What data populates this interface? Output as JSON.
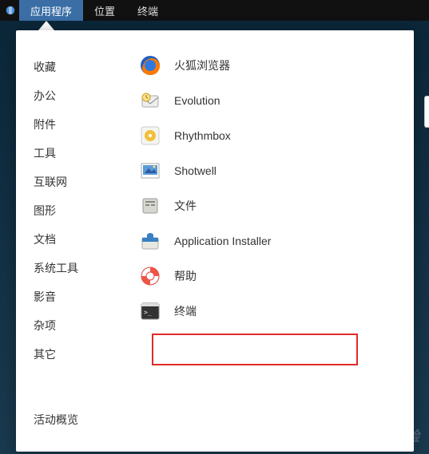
{
  "topbar": {
    "items": [
      {
        "label": "应用程序",
        "active": true
      },
      {
        "label": "位置",
        "active": false
      },
      {
        "label": "终端",
        "active": false
      }
    ]
  },
  "menu": {
    "categories": [
      "收藏",
      "办公",
      "附件",
      "工具",
      "互联网",
      "图形",
      "文档",
      "系统工具",
      "影音",
      "杂项",
      "其它"
    ],
    "activities_label": "活动概览",
    "apps": [
      {
        "name": "火狐浏览器",
        "icon": "firefox-icon"
      },
      {
        "name": "Evolution",
        "icon": "evolution-icon"
      },
      {
        "name": "Rhythmbox",
        "icon": "rhythmbox-icon"
      },
      {
        "name": "Shotwell",
        "icon": "shotwell-icon"
      },
      {
        "name": "文件",
        "icon": "files-icon"
      },
      {
        "name": "Application Installer",
        "icon": "installer-icon"
      },
      {
        "name": "帮助",
        "icon": "help-icon"
      },
      {
        "name": "终端",
        "icon": "terminal-icon"
      }
    ],
    "highlighted_index": 7
  },
  "watermark": "Baidu经验"
}
